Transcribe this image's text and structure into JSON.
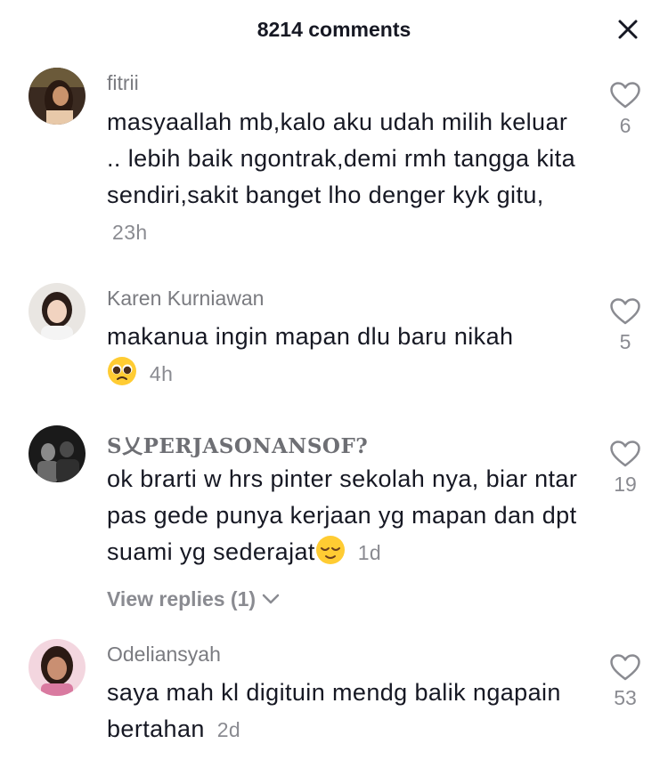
{
  "header": {
    "title": "8214 comments"
  },
  "comments": [
    {
      "username": "fitrii",
      "text": "masyaallah mb,kalo aku udah milih keluar .. lebih baik ngontrak,demi rmh tangga kita sendiri,sakit banget lho denger kyk gitu,",
      "time": "23h",
      "likes": "6"
    },
    {
      "username": "Karen Kurniawan",
      "text": "makanua ingin mapan dlu baru nikah",
      "time": "4h",
      "emoji": "pleading-face",
      "likes": "5"
    },
    {
      "username": "S乂PERJASONANSOF?",
      "text": "ok brarti w hrs pinter sekolah nya, biar ntar pas gede punya kerjaan yg mapan dan dpt suami yg sederajat",
      "time": "1d",
      "emoji": "relieved-face",
      "likes": "19",
      "view_replies": "View replies (1)"
    },
    {
      "username": "Odeliansyah",
      "text": "saya mah kl digituin mendg balik ngapain bertahan",
      "time": "2d",
      "likes": "53"
    }
  ],
  "colors": {
    "text": "#161823",
    "muted": "#8a8b91",
    "emoji": "#ffcc33"
  },
  "icons": [
    "close-icon",
    "heart-icon",
    "chevron-down-icon"
  ]
}
